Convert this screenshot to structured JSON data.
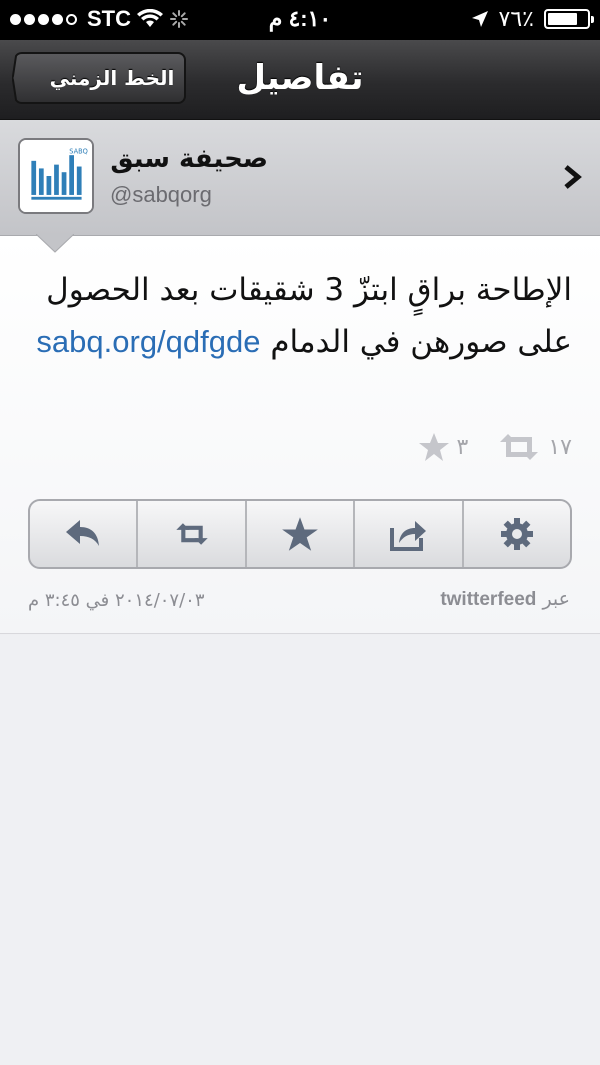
{
  "status_bar": {
    "carrier": "STC",
    "time": "٤:١٠ م",
    "battery": "٧٦٪",
    "battery_level": 0.76
  },
  "nav": {
    "title": "تفاصيل",
    "back_label": "الخط الزمني"
  },
  "profile": {
    "name": "صحيفة سبق",
    "handle": "@sabqorg",
    "avatar_text": "SABQ"
  },
  "tweet": {
    "text": "الإطاحة براقٍ ابتزّ 3 شقيقات بعد الحصول على صورهن في الدمام ",
    "link": "sabq.org/qdfgde",
    "retweet_count": "١٧",
    "favorite_count": "٣",
    "timestamp": "٢٠١٤/٠٧/٠٣ في ٣:٤٥ م",
    "via_prefix": "عبر",
    "source": "twitterfeed"
  },
  "actions": [
    {
      "name": "reply",
      "icon": "reply-icon"
    },
    {
      "name": "retweet",
      "icon": "retweet-icon"
    },
    {
      "name": "favorite",
      "icon": "star-icon"
    },
    {
      "name": "share",
      "icon": "share-icon"
    },
    {
      "name": "settings",
      "icon": "gear-icon"
    }
  ],
  "colors": {
    "link": "#2a6db5",
    "nav_bar": "#2b2b2d",
    "header": "#c9cacd"
  }
}
